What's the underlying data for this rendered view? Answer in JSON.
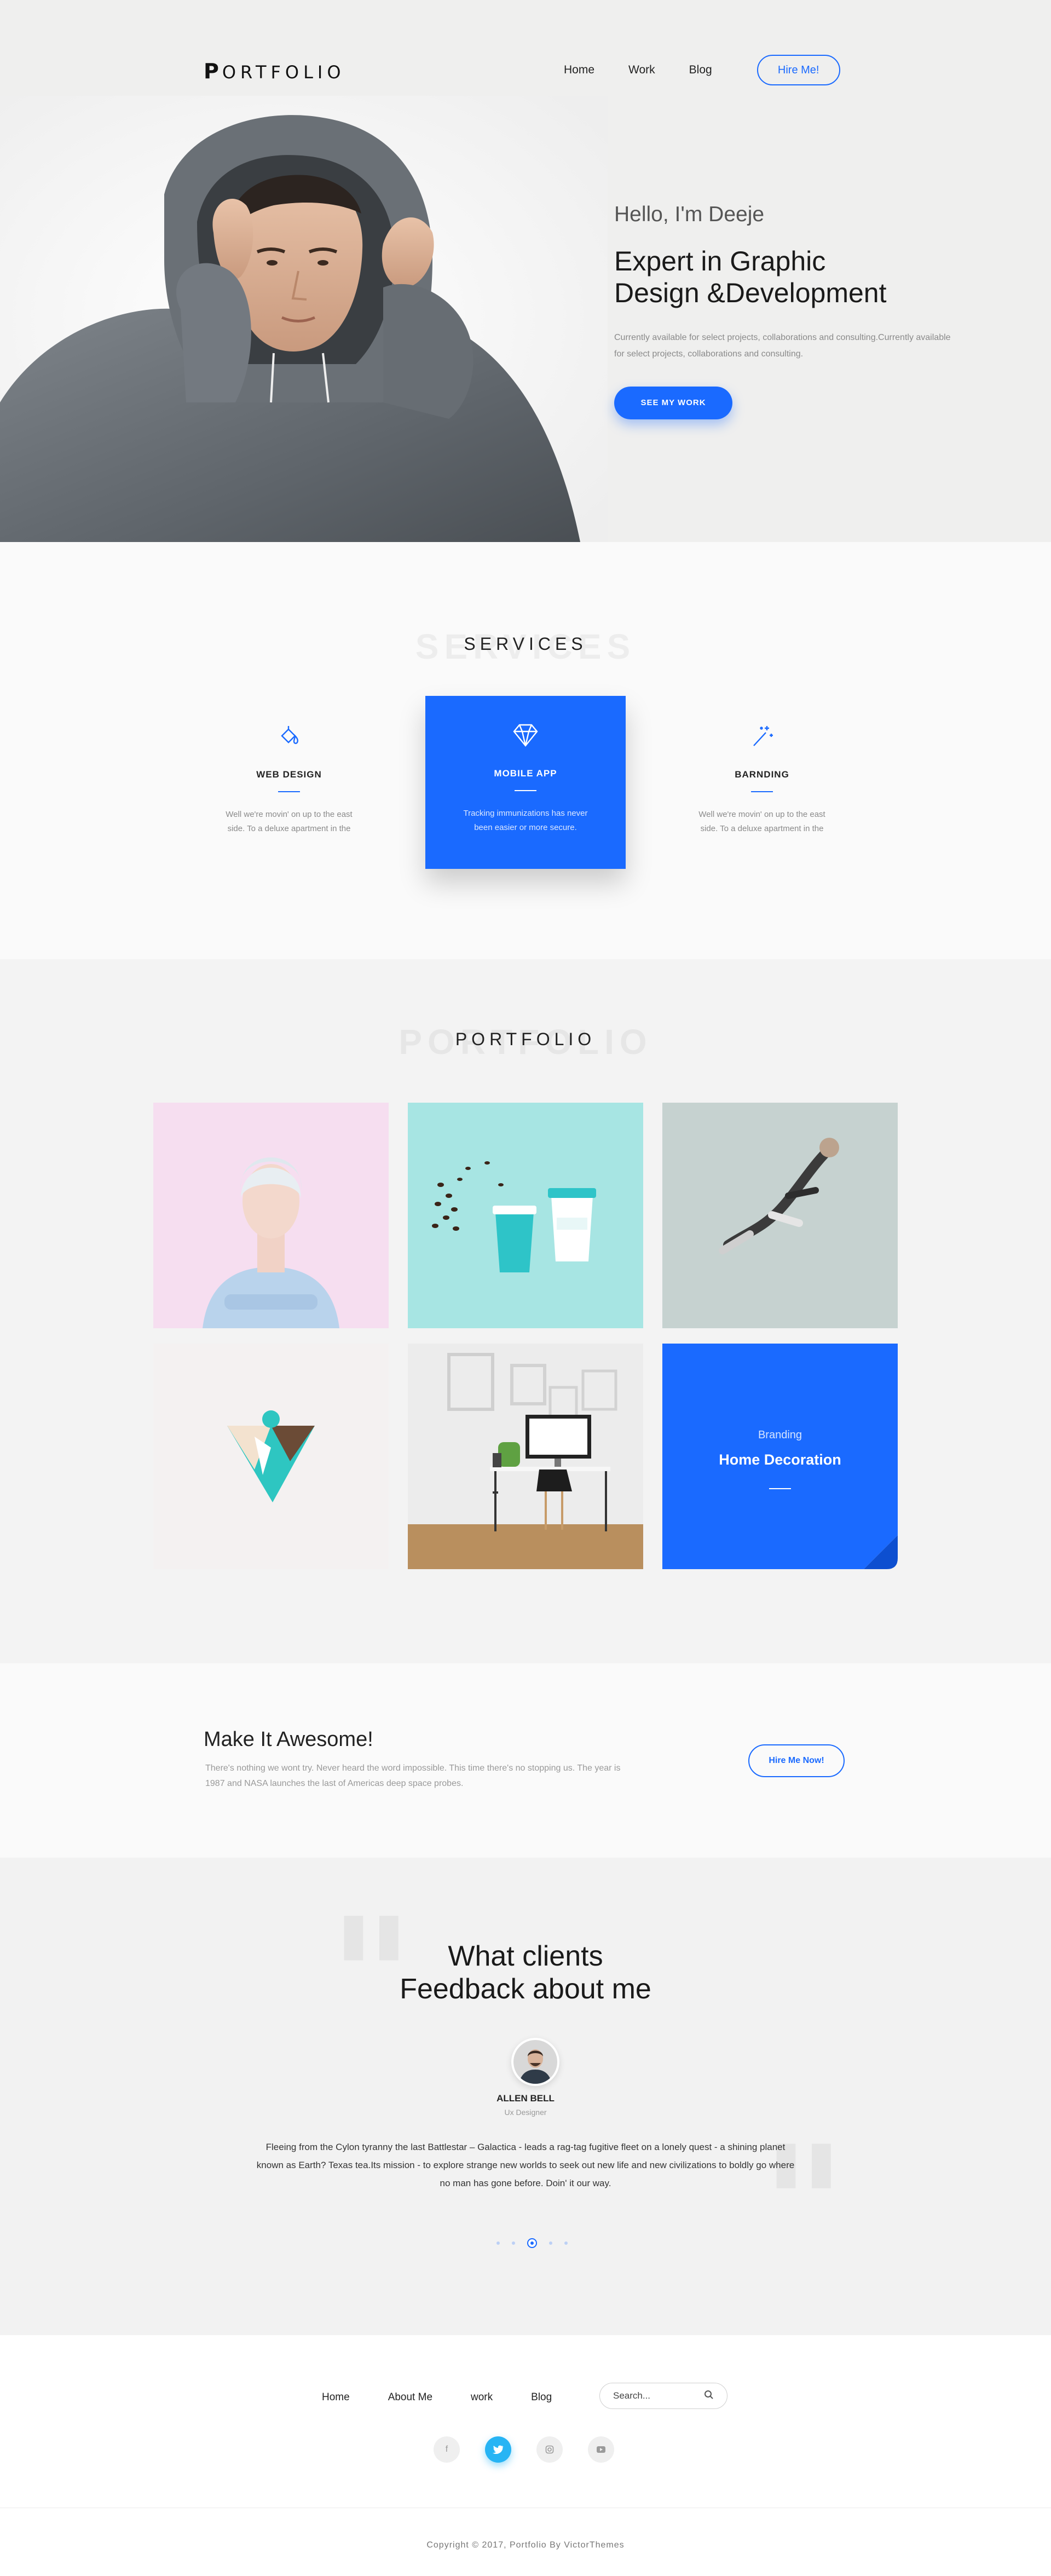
{
  "header": {
    "logo_text": "PORTFOLIO",
    "nav": [
      "Home",
      "Work",
      "Blog"
    ],
    "hire_label": "Hire Me!"
  },
  "hero": {
    "greeting": "Hello, I'm Deeje",
    "headline_line1": "Expert in Graphic",
    "headline_line2": "Design &Development",
    "description": "Currently available for select projects, collaborations and consulting.Currently available for select projects, collaborations and consulting.",
    "button_label": "SEE MY WORK"
  },
  "services": {
    "title": "SERVICES",
    "items": [
      {
        "name": "WEB DESIGN",
        "desc": "Well we're movin' on up to the east side. To a deluxe apartment in the",
        "icon": "paint-bucket-icon"
      },
      {
        "name": "MOBILE APP",
        "desc": "Tracking immunizations has never been easier or more secure.",
        "icon": "diamond-icon"
      },
      {
        "name": "BARNDING",
        "desc": "Well we're movin' on up to the east side. To a deluxe apartment in the",
        "icon": "magic-wand-icon"
      }
    ]
  },
  "portfolio": {
    "title": "PORTFOLIO",
    "featured": {
      "category": "Branding",
      "title": "Home Decoration"
    }
  },
  "cta": {
    "title": "Make It Awesome!",
    "text": "There's nothing we wont try. Never heard the word impossible. This time there's no stopping us. The year is 1987 and NASA launches the last of Americas deep space probes.",
    "button_label": "Hire Me Now!"
  },
  "testimonials": {
    "title_line1": "What clients",
    "title_line2": "Feedback about me",
    "client_name": "ALLEN BELL",
    "client_role": "Ux Designer",
    "text": "Fleeing from the Cylon tyranny the last Battlestar – Galactica - leads a rag-tag fugitive fleet on a lonely quest - a shining planet known as Earth? Texas tea.Its mission - to explore strange new worlds to seek out new life and new civilizations to boldly go where no man has gone before. Doin' it our way.",
    "slides": 5,
    "active_slide": 3
  },
  "footer": {
    "nav": [
      "Home",
      "About Me",
      "work",
      "Blog"
    ],
    "search_placeholder": "Search...",
    "socials": [
      "facebook-icon",
      "twitter-icon",
      "instagram-icon",
      "youtube-icon"
    ],
    "active_social": "twitter-icon",
    "copyright": "Copyright © 2017, Portfolio By VictorThemes"
  },
  "colors": {
    "accent": "#1a6aff",
    "twitter": "#27b4f4"
  }
}
